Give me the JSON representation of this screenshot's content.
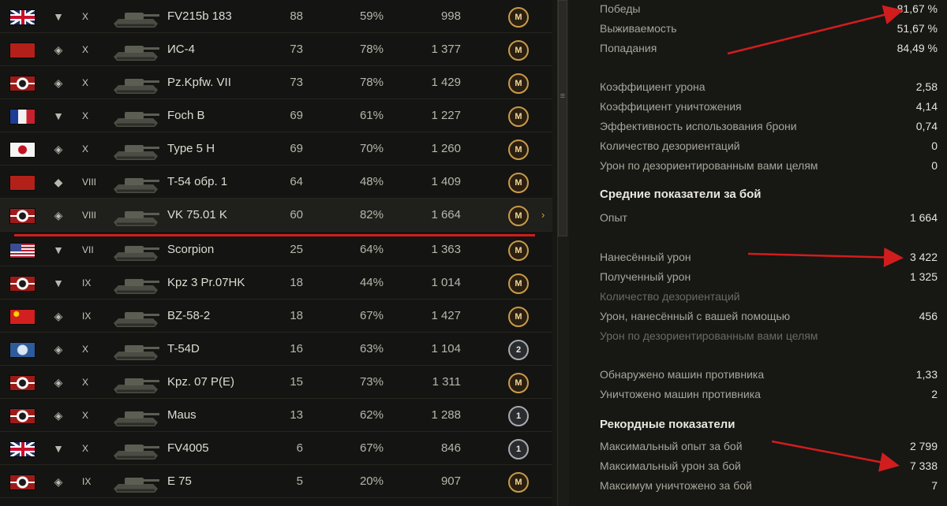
{
  "table": {
    "rows": [
      {
        "nation": "uk",
        "type": "heavy",
        "tier": "X",
        "name": "FV215b 183",
        "battles": "88",
        "win": "59%",
        "exp": "998",
        "badge": "M",
        "badge_kind": "m"
      },
      {
        "nation": "ussr",
        "type": "medium",
        "tier": "X",
        "name": "ИС-4",
        "battles": "73",
        "win": "78%",
        "exp": "1 377",
        "badge": "M",
        "badge_kind": "m"
      },
      {
        "nation": "germany",
        "type": "medium",
        "tier": "X",
        "name": "Pz.Kpfw. VII",
        "battles": "73",
        "win": "78%",
        "exp": "1 429",
        "badge": "M",
        "badge_kind": "m"
      },
      {
        "nation": "france",
        "type": "heavy",
        "tier": "X",
        "name": "Foch B",
        "battles": "69",
        "win": "61%",
        "exp": "1 227",
        "badge": "M",
        "badge_kind": "m"
      },
      {
        "nation": "japan",
        "type": "medium",
        "tier": "X",
        "name": "Type 5 H",
        "battles": "69",
        "win": "70%",
        "exp": "1 260",
        "badge": "M",
        "badge_kind": "m"
      },
      {
        "nation": "ussr",
        "type": "light",
        "tier": "VIII",
        "name": "T-54 обр. 1",
        "battles": "64",
        "win": "48%",
        "exp": "1 409",
        "badge": "M",
        "badge_kind": "m"
      },
      {
        "nation": "germany",
        "type": "medium",
        "tier": "VIII",
        "name": "VK 75.01 K",
        "battles": "60",
        "win": "82%",
        "exp": "1 664",
        "badge": "M",
        "badge_kind": "m",
        "selected": true
      },
      {
        "nation": "usa",
        "type": "heavy",
        "tier": "VII",
        "name": "Scorpion",
        "battles": "25",
        "win": "64%",
        "exp": "1 363",
        "badge": "M",
        "badge_kind": "m"
      },
      {
        "nation": "germany",
        "type": "heavy",
        "tier": "IX",
        "name": "Kpz 3 Pr.07HK",
        "battles": "18",
        "win": "44%",
        "exp": "1 014",
        "badge": "M",
        "badge_kind": "m"
      },
      {
        "nation": "china",
        "type": "medium",
        "tier": "IX",
        "name": "BZ-58-2",
        "battles": "18",
        "win": "67%",
        "exp": "1 427",
        "badge": "M",
        "badge_kind": "m"
      },
      {
        "nation": "intunion",
        "type": "medium",
        "tier": "X",
        "name": "T-54D",
        "battles": "16",
        "win": "63%",
        "exp": "1 104",
        "badge": "2",
        "badge_kind": "n"
      },
      {
        "nation": "germany",
        "type": "medium",
        "tier": "X",
        "name": "Kpz. 07 P(E)",
        "battles": "15",
        "win": "73%",
        "exp": "1 311",
        "badge": "M",
        "badge_kind": "m"
      },
      {
        "nation": "germany",
        "type": "medium",
        "tier": "X",
        "name": "Maus",
        "battles": "13",
        "win": "62%",
        "exp": "1 288",
        "badge": "1",
        "badge_kind": "n"
      },
      {
        "nation": "uk",
        "type": "heavy",
        "tier": "X",
        "name": "FV4005",
        "battles": "6",
        "win": "67%",
        "exp": "846",
        "badge": "1",
        "badge_kind": "n"
      },
      {
        "nation": "germany",
        "type": "medium",
        "tier": "IX",
        "name": "E 75",
        "battles": "5",
        "win": "20%",
        "exp": "907",
        "badge": "M",
        "badge_kind": "m"
      }
    ]
  },
  "stats": {
    "general": [
      {
        "label": "Победы",
        "value": "81,67 %"
      },
      {
        "label": "Выживаемость",
        "value": "51,67 %"
      },
      {
        "label": "Попадания",
        "value": "84,49 %"
      }
    ],
    "ratios": [
      {
        "label": "Коэффициент урона",
        "value": "2,58"
      },
      {
        "label": "Коэффициент уничтожения",
        "value": "4,14"
      },
      {
        "label": "Эффективность использования брони",
        "value": "0,74"
      },
      {
        "label": "Количество дезориентаций",
        "value": "0"
      },
      {
        "label": "Урон по дезориентированным вами целям",
        "value": "0"
      }
    ],
    "avg_title": "Средние показатели за бой",
    "avg_exp": {
      "label": "Опыт",
      "value": "1 664"
    },
    "avg_damage": [
      {
        "label": "Нанесённый урон",
        "value": "3 422",
        "muted": false
      },
      {
        "label": "Полученный урон",
        "value": "1 325",
        "muted": false
      },
      {
        "label": "Количество дезориентаций",
        "value": "",
        "muted": true
      },
      {
        "label": "Урон, нанесённый с вашей помощью",
        "value": "456",
        "muted": false
      },
      {
        "label": "Урон по дезориентированным вами целям",
        "value": "",
        "muted": true
      }
    ],
    "avg_spotting": [
      {
        "label": "Обнаружено машин противника",
        "value": "1,33"
      },
      {
        "label": "Уничтожено машин противника",
        "value": "2"
      }
    ],
    "record_title": "Рекордные показатели",
    "records": [
      {
        "label": "Максимальный опыт за бой",
        "value": "2 799"
      },
      {
        "label": "Максимальный урон за бой",
        "value": "7 338"
      },
      {
        "label": "Максимум уничтожено за бой",
        "value": "7"
      }
    ]
  },
  "icons": {
    "row_arrow": "chevron-right-icon",
    "scroll_grip": "grip-icon"
  },
  "colors": {
    "annotation_red": "#d11d1d",
    "accent_gold": "#c89b4a"
  }
}
